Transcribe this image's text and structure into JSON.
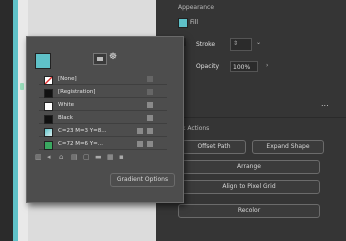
{
  "swatches": {
    "items": [
      {
        "label": "[None]",
        "color": "none"
      },
      {
        "label": "[Registration]",
        "color": "#111111"
      },
      {
        "label": "White",
        "color": "#ffffff"
      },
      {
        "label": "Black",
        "color": "#111111"
      },
      {
        "label": "C=23 M=3 Y=8...",
        "color": "gradient"
      },
      {
        "label": "C=72 M=6 Y=...",
        "color": "#3aa860"
      }
    ],
    "gradient_options_label": "Gradient Options"
  },
  "appearance": {
    "title": "Appearance",
    "fill_label": "Fill",
    "stroke_label": "Stroke",
    "opacity_label": "Opacity",
    "opacity_value": "100%",
    "more_label": "..."
  },
  "quick_actions": {
    "title": "k Actions",
    "offset_path_label": "Offset Path",
    "expand_shape_label": "Expand Shape",
    "arrange_label": "Arrange",
    "align_pixel_label": "Align to Pixel Grid",
    "recolor_label": "Recolor"
  },
  "colors": {
    "fill_swatch": "#5fc1c8",
    "panel_bg": "#353535",
    "popup_bg": "#4d4d4d",
    "teal": "#5fc1c8"
  }
}
